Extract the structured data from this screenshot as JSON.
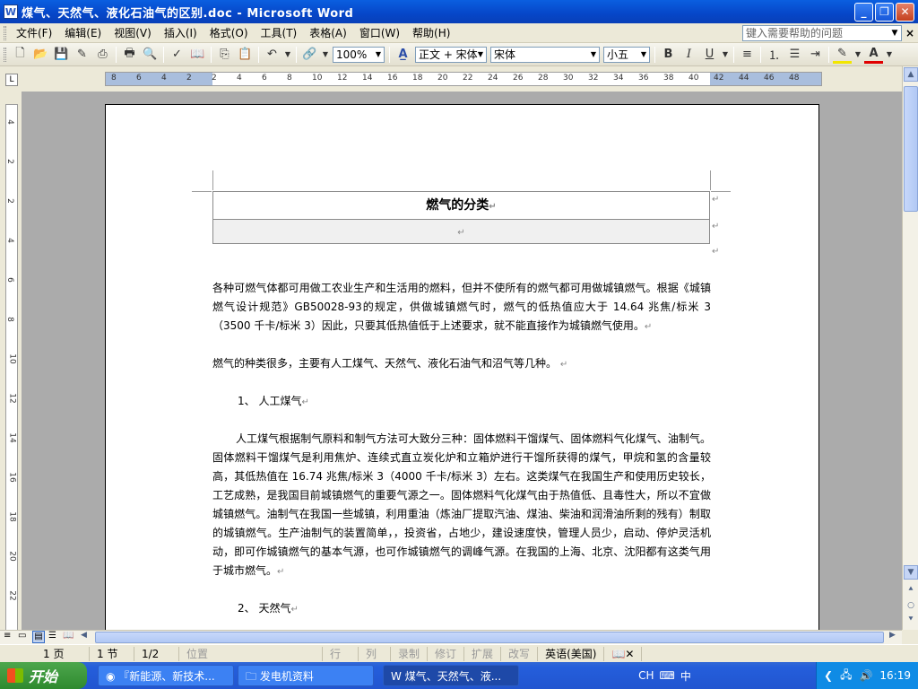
{
  "window": {
    "title": "煤气、天然气、液化石油气的区别.doc - Microsoft Word",
    "app_icon": "W"
  },
  "menu": {
    "items": [
      "文件(F)",
      "编辑(E)",
      "视图(V)",
      "插入(I)",
      "格式(O)",
      "工具(T)",
      "表格(A)",
      "窗口(W)",
      "帮助(H)"
    ],
    "help_placeholder": "键入需要帮助的问题"
  },
  "toolbar": {
    "zoom": "100%",
    "style": "正文 + 宋体",
    "font": "宋体",
    "size": "小五",
    "bold": "B",
    "italic": "I",
    "underline": "U",
    "style_icon": "A̲"
  },
  "ruler": {
    "h_ticks": [
      "8",
      "6",
      "4",
      "2",
      "2",
      "4",
      "6",
      "8",
      "10",
      "12",
      "14",
      "16",
      "18",
      "20",
      "22",
      "24",
      "26",
      "28",
      "30",
      "32",
      "34",
      "36",
      "38",
      "40",
      "42",
      "44",
      "46",
      "48"
    ],
    "v_ticks": [
      "4",
      "2",
      "2",
      "4",
      "6",
      "8",
      "10",
      "12",
      "14",
      "16",
      "18",
      "20",
      "22"
    ]
  },
  "document": {
    "heading": "燃气的分类",
    "paragraphs": [
      "各种可燃气体都可用做工农业生产和生活用的燃料，但并不使所有的燃气都可用做城镇燃气。根据《城镇燃气设计规范》GB50028-93的规定，供做城镇燃气时，燃气的低热值应大于 14.64 兆焦/标米 3（3500 千卡/标米 3）因此，只要其低热值低于上述要求，就不能直接作为城镇燃气使用。",
      "燃气的种类很多，主要有人工煤气、天然气、液化石油气和沼气等几种。",
      "1、  人工煤气",
      "人工煤气根据制气原料和制气方法可大致分三种：固体燃料干馏煤气、固体燃料气化煤气、油制气。固体燃料干馏煤气是利用焦炉、连续式直立炭化炉和立箱炉进行干馏所获得的煤气，甲烷和氢的含量较高，其低热值在 16.74 兆焦/标米 3（4000 千卡/标米 3）左右。这类煤气在我国生产和使用历史较长，工艺成熟，是我国目前城镇燃气的重要气源之一。固体燃料气化煤气由于热值低、且毒性大，所以不宜做城镇燃气。油制气在我国一些城镇，利用重油（炼油厂提取汽油、煤油、柴油和润滑油所剩的残有）制取的城镇燃气。生产油制气的装置简单，，投资省，占地少，建设速度快，管理人员少，启动、停炉灵活机动，即可作城镇燃气的基本气源，也可作城镇燃气的调峰气源。在我国的上海、北京、沈阳都有这类气用于城市燃气。",
      "2、  天然气"
    ],
    "para_mark": "↵"
  },
  "status": {
    "page": "1 页",
    "section": "1 节",
    "page_of": "1/2",
    "at": "位置",
    "line": "行",
    "col": "列",
    "rec": "录制",
    "trk": "修订",
    "ext": "扩展",
    "ovr": "改写",
    "lang": "英语(美国)"
  },
  "taskbar": {
    "start": "开始",
    "buttons": [
      "『新能源、新技术...",
      "发电机资料",
      "煤气、天然气、液..."
    ],
    "tray_lang": "CH",
    "tray_ime": "中",
    "clock": "16:19"
  }
}
